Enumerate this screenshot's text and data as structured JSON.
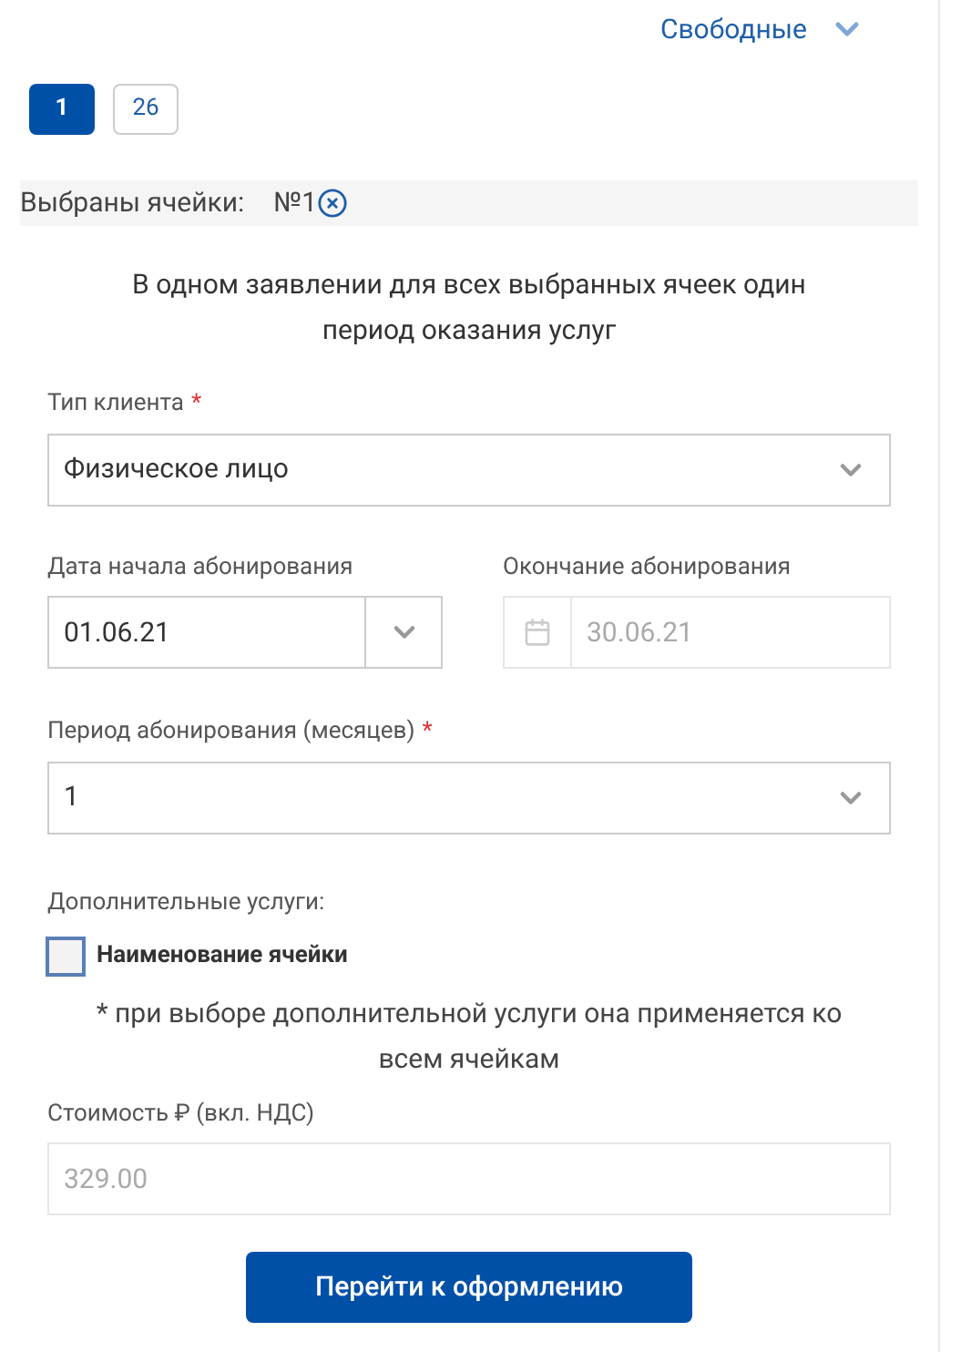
{
  "filter": {
    "label": "Свободные",
    "expanded": false
  },
  "cell_pages": [
    {
      "label": "1",
      "selected": true
    },
    {
      "label": "26",
      "selected": false
    }
  ],
  "selected_cells": {
    "label": "Выбраны ячейки:",
    "cells": [
      "№1"
    ]
  },
  "period_note": "В одном заявлении для всех выбранных ячеек один период оказания услуг",
  "client_type": {
    "label": "Тип клиента",
    "required_mark": "*",
    "value": "Физическое лицо"
  },
  "start_date": {
    "label": "Дата начала абонирования",
    "value": "01.06.21",
    "disabled": false
  },
  "end_date": {
    "label": "Окончание абонирования",
    "value": "30.06.21",
    "disabled": true
  },
  "period": {
    "label": "Период абонирования (месяцев)",
    "required_mark": "*",
    "value": "1"
  },
  "extra_services": {
    "label": "Дополнительные услуги:",
    "options": [
      {
        "label": "Наименование ячейки",
        "checked": false
      }
    ]
  },
  "extra_note": "* при выборе дополнительной услуги она применяется ко всем ячейкам",
  "cost": {
    "label": "Стоимость ₽ (вкл. НДС)",
    "value": "329.00",
    "disabled": true
  },
  "submit": "Перейти к оформлению"
}
